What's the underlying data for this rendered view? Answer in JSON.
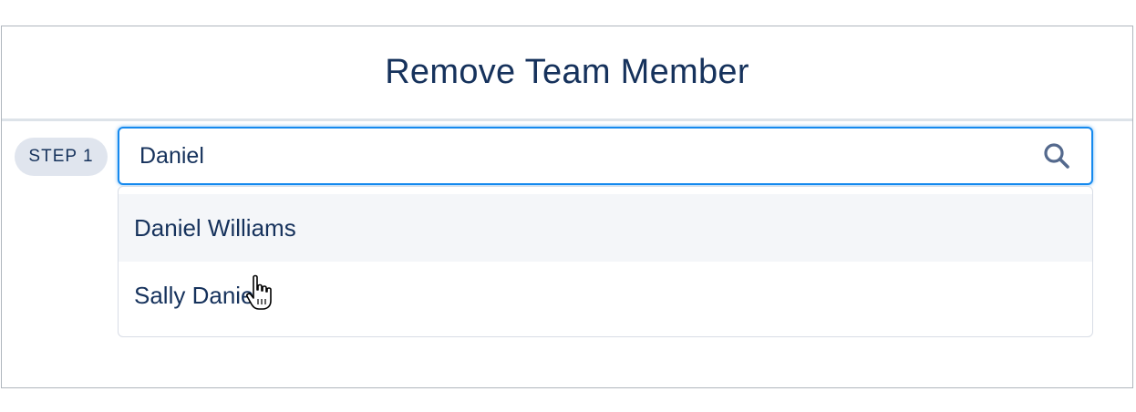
{
  "modal": {
    "title": "Remove Team Member"
  },
  "step": {
    "label": "STEP 1"
  },
  "search": {
    "value": "Daniel"
  },
  "results": [
    {
      "name": "Daniel Williams",
      "highlighted": true
    },
    {
      "name": "Sally Daniels",
      "highlighted": false
    }
  ],
  "colors": {
    "title_text": "#16325c",
    "focus_border": "#1589ee",
    "badge_bg": "#e0e5ee",
    "hover_bg": "#f4f6f9"
  },
  "icons": {
    "search": "search-icon",
    "cursor": "pointer-hand-cursor"
  }
}
